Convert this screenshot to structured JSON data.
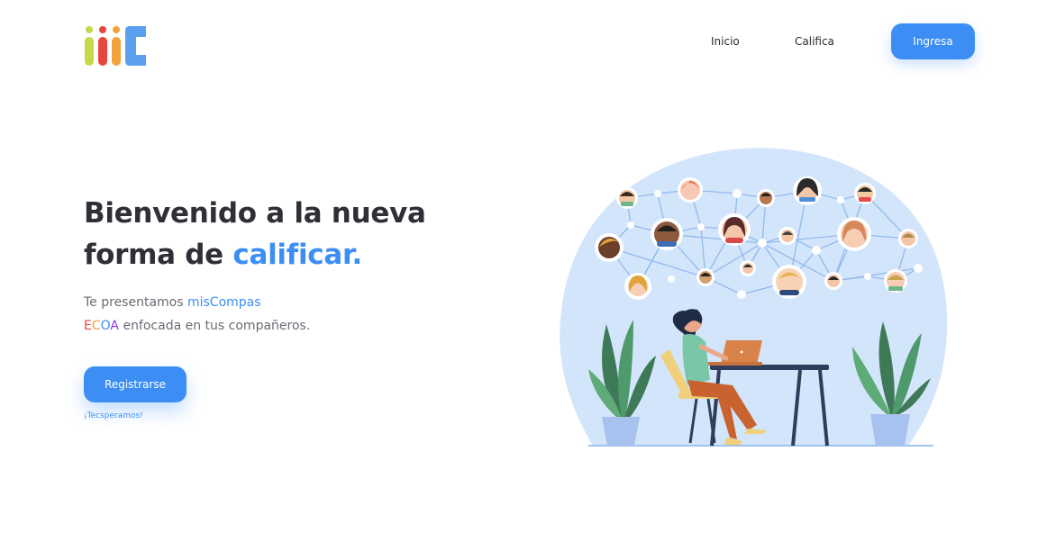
{
  "header": {
    "nav": [
      {
        "label": "Inicio"
      },
      {
        "label": "Califica"
      }
    ],
    "login_button": "Ingresa"
  },
  "hero": {
    "title_line1": "Bienvenido a la nueva",
    "title_line2_prefix": "forma de ",
    "title_line2_accent": "calificar.",
    "subtitle_prefix": "Te presentamos ",
    "subtitle_brand": "misCompas",
    "ecoa": [
      "E",
      "C",
      "O",
      "A"
    ],
    "subtitle2_suffix": " enfocada en tus compañeros.",
    "register_button": "Registrarse",
    "tagline": "¡Tecsperamos!"
  },
  "colors": {
    "accent": "#3d8ef4",
    "logo_bars": [
      "#c5d94a",
      "#e8453c",
      "#f2a23a",
      "#5aa0ee"
    ]
  },
  "icons": {
    "logo": "misCompas-logo",
    "illustration": "network-people-illustration"
  }
}
